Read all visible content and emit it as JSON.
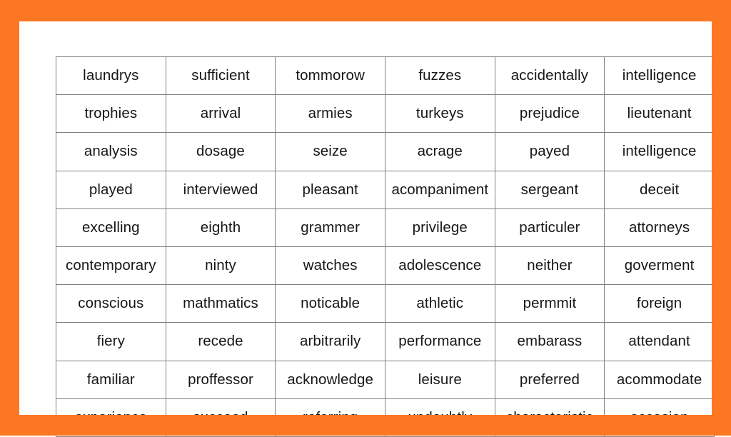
{
  "page": {
    "frame_color": "#FD7722",
    "paper_color": "#FFFFFF",
    "table_border_color": "#808080",
    "text_color": "#171717"
  },
  "table": {
    "columns": 6,
    "rows_count": 10,
    "rows": [
      [
        "laundrys",
        "sufficient",
        "tommorow",
        "fuzzes",
        "accidentally",
        "intelligence"
      ],
      [
        "trophies",
        "arrival",
        "armies",
        "turkeys",
        "prejudice",
        "lieutenant"
      ],
      [
        "analysis",
        "dosage",
        "seize",
        "acrage",
        "payed",
        "intelligence"
      ],
      [
        "played",
        "interviewed",
        "pleasant",
        "acompaniment",
        "sergeant",
        "deceit"
      ],
      [
        "excelling",
        "eighth",
        "grammer",
        "privilege",
        "particuler",
        "attorneys"
      ],
      [
        "contemporary",
        "ninty",
        "watches",
        "adolescence",
        "neither",
        "goverment"
      ],
      [
        "conscious",
        "mathmatics",
        "noticable",
        "athletic",
        "permmit",
        "foreign"
      ],
      [
        "fiery",
        "recede",
        "arbitrarily",
        "performance",
        "embarass",
        "attendant"
      ],
      [
        "familiar",
        "proffessor",
        "acknowledge",
        "leisure",
        "preferred",
        "acommodate"
      ],
      [
        "experience",
        "succeed",
        "referring",
        "undoubtly",
        "characteristic",
        "occasion"
      ]
    ]
  }
}
